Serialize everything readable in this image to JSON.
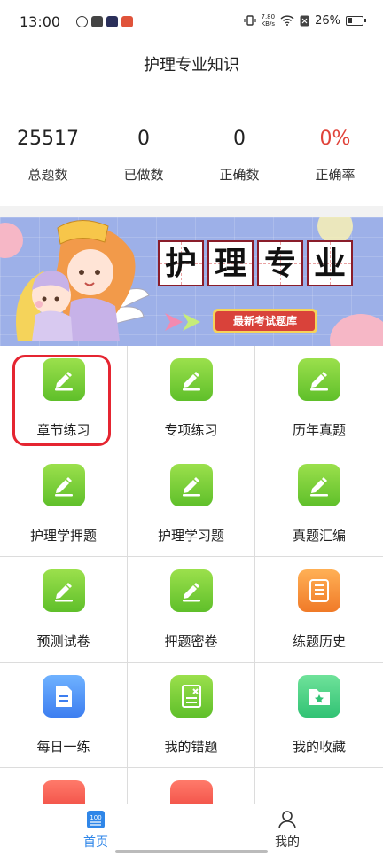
{
  "status_bar": {
    "time": "13:00",
    "net_speed_value": "7.80",
    "net_speed_unit": "KB/s",
    "battery": "26%"
  },
  "page_title": "护理专业知识",
  "stats": [
    {
      "value": "25517",
      "label": "总题数",
      "color": "#222222"
    },
    {
      "value": "0",
      "label": "已做数",
      "color": "#222222"
    },
    {
      "value": "0",
      "label": "正确数",
      "color": "#222222"
    },
    {
      "value": "0%",
      "label": "正确率",
      "color": "#e0433a"
    }
  ],
  "banner": {
    "chars": [
      "护",
      "理",
      "专",
      "业"
    ],
    "tag": "最新考试题库"
  },
  "menu": [
    {
      "label": "章节练习",
      "icon": "pencil-icon",
      "color": "green"
    },
    {
      "label": "专项练习",
      "icon": "pencil-icon",
      "color": "green"
    },
    {
      "label": "历年真题",
      "icon": "pencil-icon",
      "color": "green"
    },
    {
      "label": "护理学押题",
      "icon": "pencil-icon",
      "color": "green"
    },
    {
      "label": "护理学习题",
      "icon": "pencil-icon",
      "color": "green"
    },
    {
      "label": "真题汇编",
      "icon": "pencil-icon",
      "color": "green"
    },
    {
      "label": "预测试卷",
      "icon": "pencil-icon",
      "color": "green"
    },
    {
      "label": "押题密卷",
      "icon": "pencil-icon",
      "color": "green"
    },
    {
      "label": "练题历史",
      "icon": "history-list-icon",
      "color": "orange"
    },
    {
      "label": "每日一练",
      "icon": "document-icon",
      "color": "blue"
    },
    {
      "label": "我的错题",
      "icon": "wrong-notebook-icon",
      "color": "green"
    },
    {
      "label": "我的收藏",
      "icon": "star-folder-icon",
      "color": "teal"
    }
  ],
  "bottom_nav": [
    {
      "label": "首页",
      "icon": "home-100-icon",
      "active": true
    },
    {
      "label": "我的",
      "icon": "person-icon",
      "active": false
    }
  ]
}
